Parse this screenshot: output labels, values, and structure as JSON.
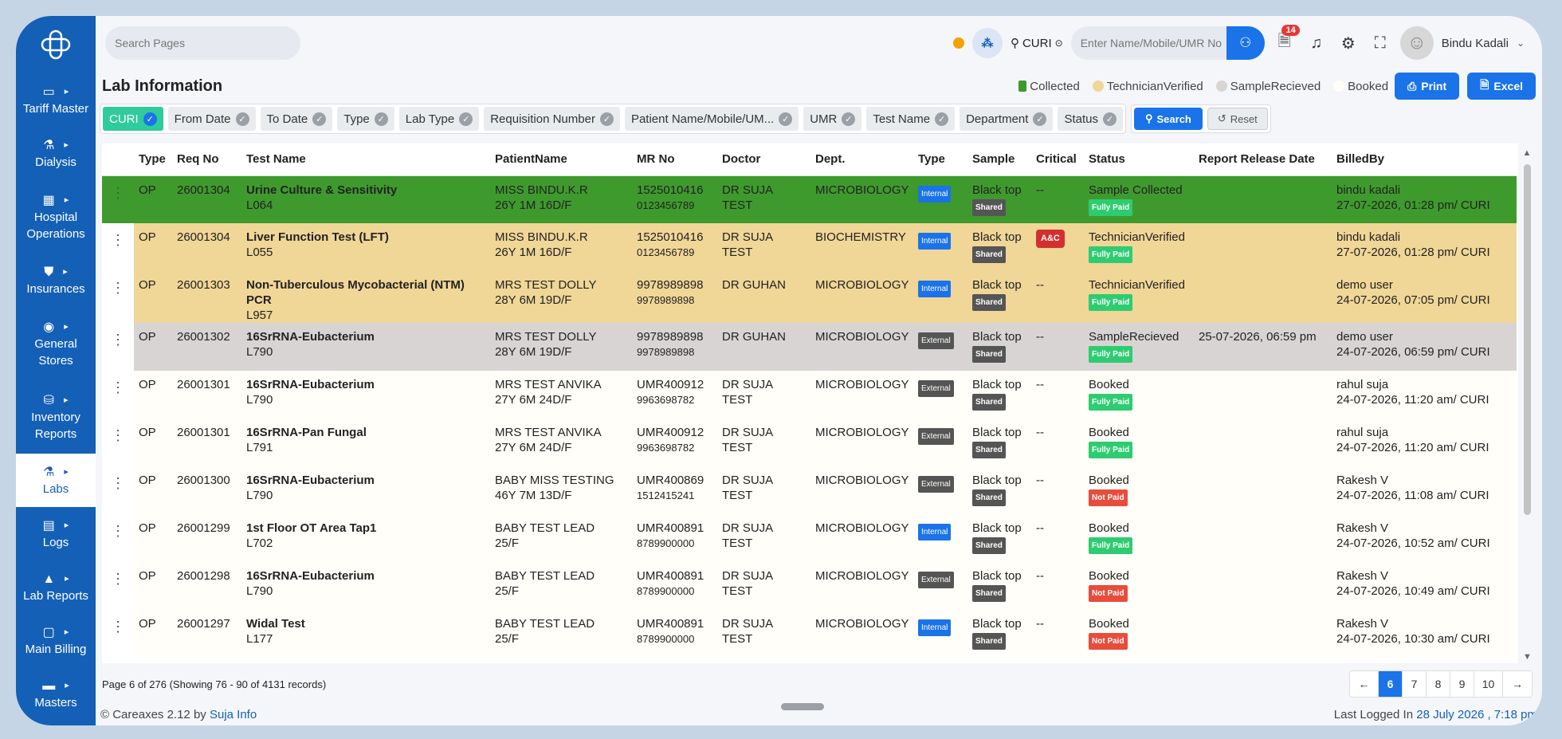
{
  "sidebar": {
    "items": [
      {
        "label": "Tariff Master",
        "icon": "tariff-icon",
        "glyph": "▭"
      },
      {
        "label": "Dialysis",
        "icon": "test-tube-icon",
        "glyph": "⚗"
      },
      {
        "label": "Hospital Operations",
        "icon": "hospital-icon",
        "glyph": "▦"
      },
      {
        "label": "Insurances",
        "icon": "shield-icon",
        "glyph": "⛊"
      },
      {
        "label": "General Stores",
        "icon": "store-icon",
        "glyph": "◉"
      },
      {
        "label": "Inventory Reports",
        "icon": "inventory-icon",
        "glyph": "⛁"
      },
      {
        "label": "Labs",
        "icon": "flask-icon",
        "glyph": "⚗"
      },
      {
        "label": "Logs",
        "icon": "book-icon",
        "glyph": "▤"
      },
      {
        "label": "Lab Reports",
        "icon": "warning-icon",
        "glyph": "▲"
      },
      {
        "label": "Main Billing",
        "icon": "billing-icon",
        "glyph": "▢"
      },
      {
        "label": "Masters",
        "icon": "masters-icon",
        "glyph": "▬"
      }
    ]
  },
  "topbar": {
    "search_placeholder": "Search Pages",
    "location": "CURI",
    "umr_placeholder": "Enter Name/Mobile/UMR No",
    "notification_count": "14",
    "user_name": "Bindu Kadali"
  },
  "header": {
    "title": "Lab Information",
    "legend": [
      {
        "label": "Collected",
        "color": "#3f9a2e"
      },
      {
        "label": "TechnicianVerified",
        "color": "#f0d697"
      },
      {
        "label": "SampleRecieved",
        "color": "#d9d4d4"
      },
      {
        "label": "Booked",
        "color": "#fffef8"
      }
    ],
    "print_label": "Print",
    "excel_label": "Excel"
  },
  "filters": {
    "chips": [
      "CURI",
      "From Date",
      "To Date",
      "Type",
      "Lab Type",
      "Requisition Number",
      "Patient Name/Mobile/UM...",
      "UMR",
      "Test Name",
      "Department",
      "Status"
    ],
    "search_label": "Search",
    "reset_label": "Reset"
  },
  "table": {
    "columns": [
      "",
      "Type",
      "Req No",
      "Test Name",
      "PatientName",
      "MR No",
      "Doctor",
      "Dept.",
      "Type",
      "Sample",
      "Critical",
      "Status",
      "Report Release Date",
      "BilledBy"
    ],
    "rows": [
      {
        "row_class": "r-collected",
        "type": "OP",
        "req": "26001304",
        "test": "Urine Culture & Sensitivity",
        "code": "L064",
        "patient": "MISS BINDU.K.R",
        "age": "26Y 1M 16D/F",
        "mr": "1525010416",
        "phone": "0123456789",
        "doctor": "DR SUJA TEST",
        "dept": "MICROBIOLOGY",
        "lab_type": "Internal",
        "sample": "Black top",
        "shared": "Shared",
        "critical": "--",
        "status": "Sample Collected",
        "payment": "Fully Paid",
        "release": "",
        "billed_by": "bindu kadali",
        "billed_at": "27-07-2026, 01:28 pm/ CURI"
      },
      {
        "row_class": "r-verified",
        "type": "OP",
        "req": "26001304",
        "test": "Liver Function Test (LFT)",
        "code": "L055",
        "patient": "MISS BINDU.K.R",
        "age": "26Y 1M 16D/F",
        "mr": "1525010416",
        "phone": "0123456789",
        "doctor": "DR SUJA TEST",
        "dept": "BIOCHEMISTRY",
        "lab_type": "Internal",
        "sample": "Black top",
        "shared": "Shared",
        "critical": "A&C",
        "status": "TechnicianVerified",
        "payment": "Fully Paid",
        "release": "",
        "billed_by": "bindu kadali",
        "billed_at": "27-07-2026, 01:28 pm/ CURI"
      },
      {
        "row_class": "r-verified",
        "type": "OP",
        "req": "26001303",
        "test": "Non-Tuberculous Mycobacterial (NTM) PCR",
        "code": "L957",
        "patient": "MRS TEST DOLLY",
        "age": "28Y 6M 19D/F",
        "mr": "9978989898",
        "phone": "9978989898",
        "doctor": "DR GUHAN",
        "dept": "MICROBIOLOGY",
        "lab_type": "Internal",
        "sample": "Black top",
        "shared": "Shared",
        "critical": "--",
        "status": "TechnicianVerified",
        "payment": "Fully Paid",
        "release": "",
        "billed_by": "demo user",
        "billed_at": "24-07-2026, 07:05 pm/ CURI"
      },
      {
        "row_class": "r-received",
        "type": "OP",
        "req": "26001302",
        "test": "16SrRNA-Eubacterium",
        "code": "L790",
        "patient": "MRS TEST DOLLY",
        "age": "28Y 6M 19D/F",
        "mr": "9978989898",
        "phone": "9978989898",
        "doctor": "DR GUHAN",
        "dept": "MICROBIOLOGY",
        "lab_type": "External",
        "sample": "Black top",
        "shared": "Shared",
        "critical": "--",
        "status": "SampleRecieved",
        "payment": "Fully Paid",
        "release": "25-07-2026, 06:59 pm",
        "billed_by": "demo user",
        "billed_at": "24-07-2026, 06:59 pm/ CURI"
      },
      {
        "row_class": "r-booked",
        "type": "OP",
        "req": "26001301",
        "test": "16SrRNA-Eubacterium",
        "code": "L790",
        "patient": "MRS TEST ANVIKA",
        "age": "27Y 6M 24D/F",
        "mr": "UMR400912",
        "phone": "9963698782",
        "doctor": "DR SUJA TEST",
        "dept": "MICROBIOLOGY",
        "lab_type": "External",
        "sample": "Black top",
        "shared": "Shared",
        "critical": "--",
        "status": "Booked",
        "payment": "Fully Paid",
        "release": "",
        "billed_by": "rahul suja",
        "billed_at": "24-07-2026, 11:20 am/ CURI"
      },
      {
        "row_class": "r-booked",
        "type": "OP",
        "req": "26001301",
        "test": "16SrRNA-Pan Fungal",
        "code": "L791",
        "patient": "MRS TEST ANVIKA",
        "age": "27Y 6M 24D/F",
        "mr": "UMR400912",
        "phone": "9963698782",
        "doctor": "DR SUJA TEST",
        "dept": "MICROBIOLOGY",
        "lab_type": "External",
        "sample": "Black top",
        "shared": "Shared",
        "critical": "--",
        "status": "Booked",
        "payment": "Fully Paid",
        "release": "",
        "billed_by": "rahul suja",
        "billed_at": "24-07-2026, 11:20 am/ CURI"
      },
      {
        "row_class": "r-booked",
        "type": "OP",
        "req": "26001300",
        "test": "16SrRNA-Eubacterium",
        "code": "L790",
        "patient": "BABY MISS TESTING",
        "age": "46Y 7M 13D/F",
        "mr": "UMR400869",
        "phone": "1512415241",
        "doctor": "DR SUJA TEST",
        "dept": "MICROBIOLOGY",
        "lab_type": "External",
        "sample": "Black top",
        "shared": "Shared",
        "critical": "--",
        "status": "Booked",
        "payment": "Not Paid",
        "release": "",
        "billed_by": "Rakesh V",
        "billed_at": "24-07-2026, 11:08 am/ CURI"
      },
      {
        "row_class": "r-booked",
        "type": "OP",
        "req": "26001299",
        "test": "1st Floor OT Area Tap1",
        "code": "L702",
        "patient": "BABY TEST LEAD",
        "age": "25/F",
        "mr": "UMR400891",
        "phone": "8789900000",
        "doctor": "DR SUJA TEST",
        "dept": "MICROBIOLOGY",
        "lab_type": "Internal",
        "sample": "Black top",
        "shared": "Shared",
        "critical": "--",
        "status": "Booked",
        "payment": "Fully Paid",
        "release": "",
        "billed_by": "Rakesh V",
        "billed_at": "24-07-2026, 10:52 am/ CURI"
      },
      {
        "row_class": "r-booked",
        "type": "OP",
        "req": "26001298",
        "test": "16SrRNA-Eubacterium",
        "code": "L790",
        "patient": "BABY TEST LEAD",
        "age": "25/F",
        "mr": "UMR400891",
        "phone": "8789900000",
        "doctor": "DR SUJA TEST",
        "dept": "MICROBIOLOGY",
        "lab_type": "External",
        "sample": "Black top",
        "shared": "Shared",
        "critical": "--",
        "status": "Booked",
        "payment": "Not Paid",
        "release": "",
        "billed_by": "Rakesh V",
        "billed_at": "24-07-2026, 10:49 am/ CURI"
      },
      {
        "row_class": "r-booked",
        "type": "OP",
        "req": "26001297",
        "test": "Widal Test",
        "code": "L177",
        "patient": "BABY TEST LEAD",
        "age": "25/F",
        "mr": "UMR400891",
        "phone": "8789900000",
        "doctor": "DR SUJA TEST",
        "dept": "MICROBIOLOGY",
        "lab_type": "Internal",
        "sample": "Black top",
        "shared": "Shared",
        "critical": "--",
        "status": "Booked",
        "payment": "Not Paid",
        "release": "",
        "billed_by": "Rakesh V",
        "billed_at": "24-07-2026, 10:30 am/ CURI"
      }
    ]
  },
  "pager": {
    "info": "Page 6 of 276",
    "records": "(Showing 76 - 90 of 4131 records)",
    "prev": "←",
    "pages": [
      "6",
      "7",
      "8",
      "9",
      "10"
    ],
    "active": "6",
    "next": "→"
  },
  "footer": {
    "copyright": "© Careaxes 2.12 by",
    "company": "Suja Info",
    "last_login_label": "Last Logged In",
    "last_login_value": "28 July 2026 , 7:18 pm"
  }
}
